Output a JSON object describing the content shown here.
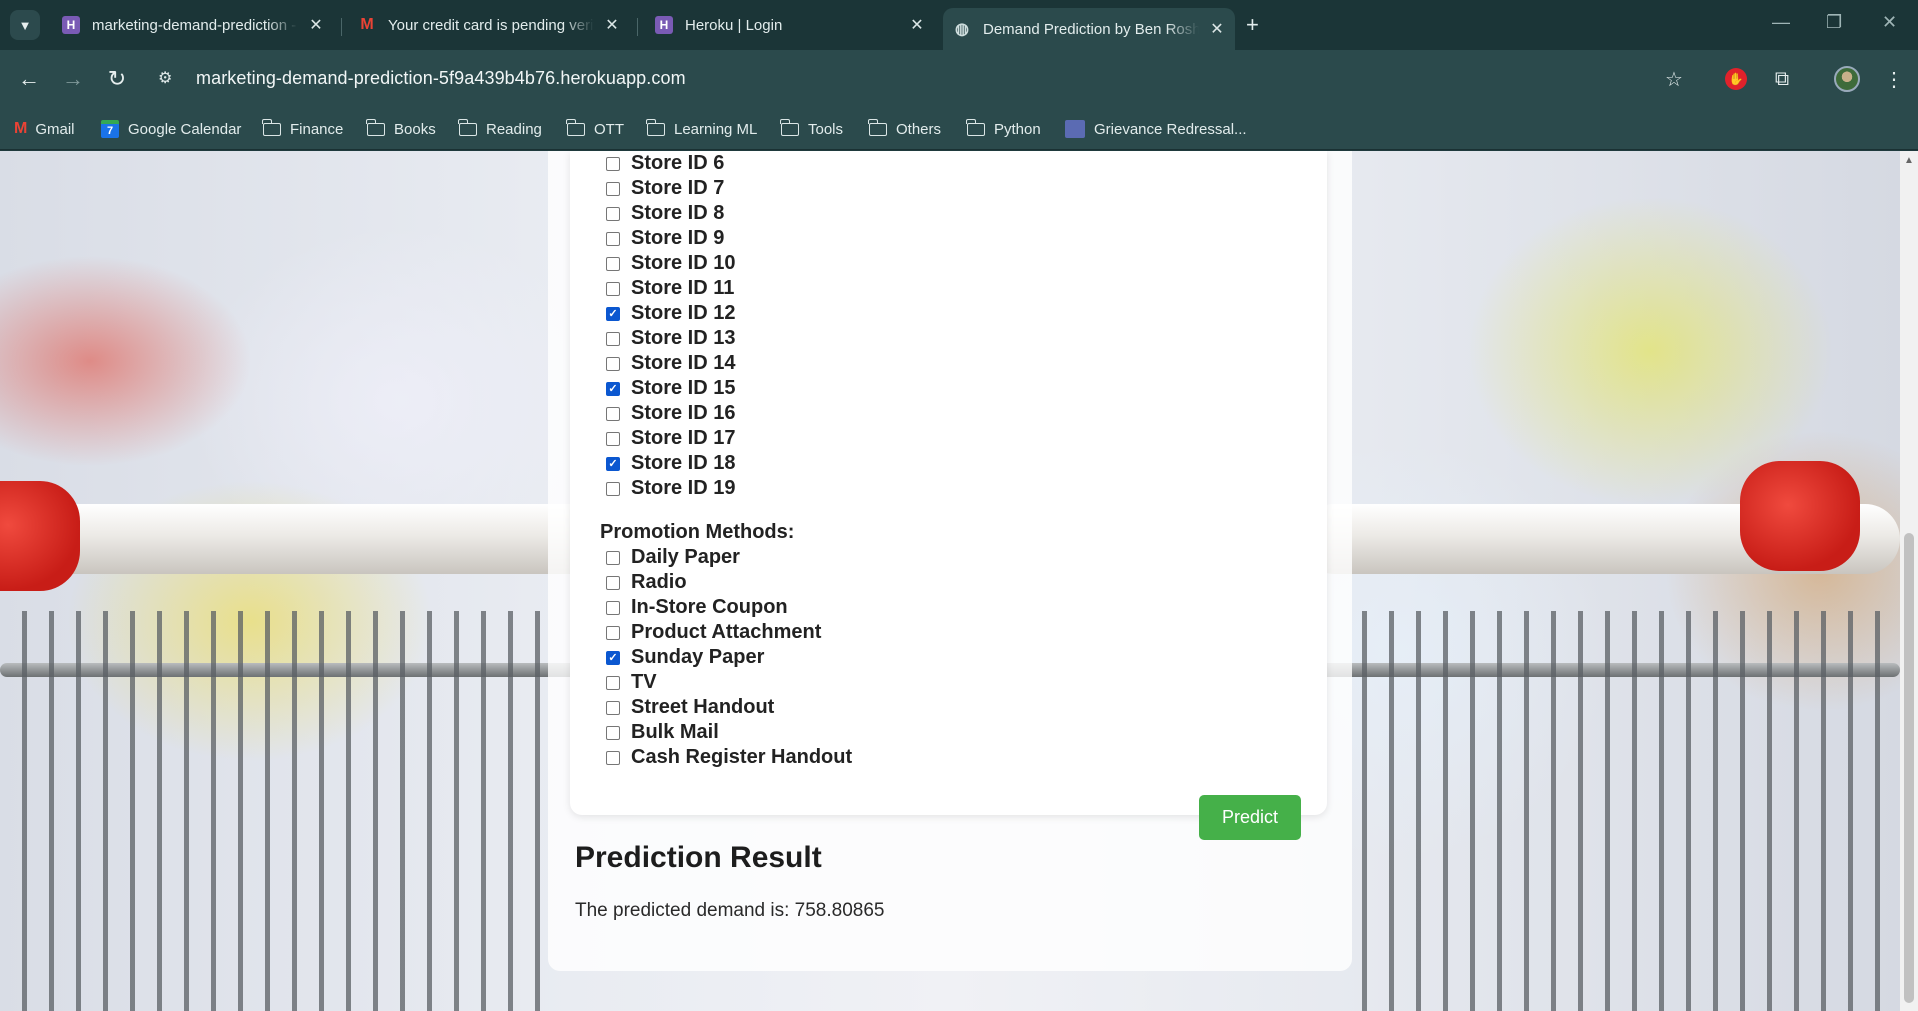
{
  "browser": {
    "tabs": [
      {
        "title": "marketing-demand-prediction - ",
        "icon": "heroku-icon",
        "active": false
      },
      {
        "title": "Your credit card is pending verification",
        "icon": "gmail-icon",
        "active": false
      },
      {
        "title": "Heroku | Login",
        "icon": "heroku-icon",
        "active": false
      },
      {
        "title": "Demand Prediction by Ben Rosh",
        "icon": "globe-icon",
        "active": true
      }
    ],
    "url": "marketing-demand-prediction-5f9a439b4b76.herokuapp.com",
    "bookmarks": [
      {
        "label": "Gmail",
        "icon": "gmail-icon"
      },
      {
        "label": "Google Calendar",
        "icon": "calendar-icon"
      },
      {
        "label": "Finance",
        "icon": "folder-icon"
      },
      {
        "label": "Books",
        "icon": "folder-icon"
      },
      {
        "label": "Reading",
        "icon": "folder-icon"
      },
      {
        "label": "OTT",
        "icon": "folder-icon"
      },
      {
        "label": "Learning ML",
        "icon": "folder-icon"
      },
      {
        "label": "Tools",
        "icon": "folder-icon"
      },
      {
        "label": "Others",
        "icon": "folder-icon"
      },
      {
        "label": "Python",
        "icon": "folder-icon"
      },
      {
        "label": "Grievance Redressal...",
        "icon": "grievance-icon"
      }
    ]
  },
  "stores": [
    {
      "label": "Store ID 6",
      "checked": false
    },
    {
      "label": "Store ID 7",
      "checked": false
    },
    {
      "label": "Store ID 8",
      "checked": false
    },
    {
      "label": "Store ID 9",
      "checked": false
    },
    {
      "label": "Store ID 10",
      "checked": false
    },
    {
      "label": "Store ID 11",
      "checked": false
    },
    {
      "label": "Store ID 12",
      "checked": true
    },
    {
      "label": "Store ID 13",
      "checked": false
    },
    {
      "label": "Store ID 14",
      "checked": false
    },
    {
      "label": "Store ID 15",
      "checked": true
    },
    {
      "label": "Store ID 16",
      "checked": false
    },
    {
      "label": "Store ID 17",
      "checked": false
    },
    {
      "label": "Store ID 18",
      "checked": true
    },
    {
      "label": "Store ID 19",
      "checked": false
    }
  ],
  "promotion": {
    "heading": "Promotion Methods:",
    "methods": [
      {
        "label": "Daily Paper",
        "checked": false
      },
      {
        "label": "Radio",
        "checked": false
      },
      {
        "label": "In-Store Coupon",
        "checked": false
      },
      {
        "label": "Product Attachment",
        "checked": false
      },
      {
        "label": "Sunday Paper",
        "checked": true
      },
      {
        "label": "TV",
        "checked": false
      },
      {
        "label": "Street Handout",
        "checked": false
      },
      {
        "label": "Bulk Mail",
        "checked": false
      },
      {
        "label": "Cash Register Handout",
        "checked": false
      }
    ]
  },
  "predict_button": "Predict",
  "result": {
    "title": "Prediction Result",
    "text": "The predicted demand is: 758.80865"
  },
  "colors": {
    "chrome_dark": "#1b3537",
    "chrome": "#2b4a4c",
    "checkbox_checked": "#0b57d0",
    "predict_button": "#45b049"
  }
}
